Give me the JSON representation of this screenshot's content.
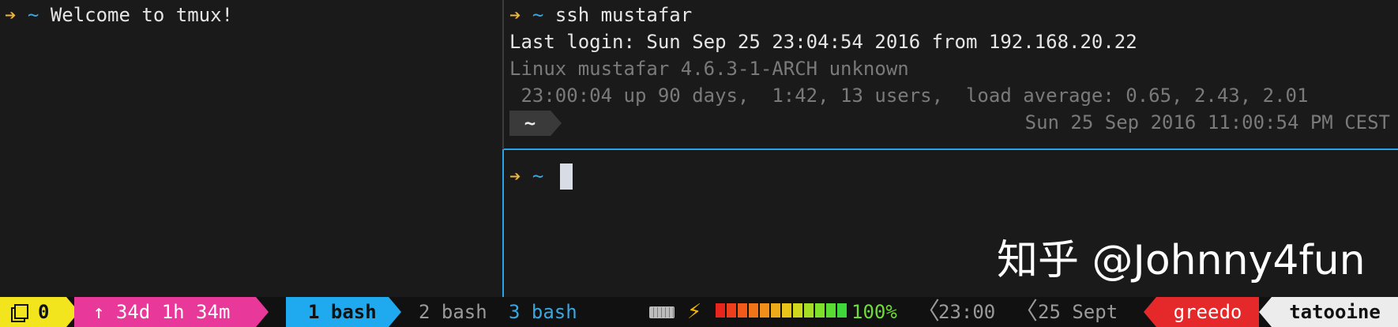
{
  "left_pane": {
    "prompt_arrow": "➔",
    "prompt_dir": "~",
    "message": "Welcome to tmux!"
  },
  "top_pane": {
    "prompt_arrow": "➔",
    "prompt_dir": "~",
    "command": "ssh mustafar",
    "last_login": "Last login: Sun Sep 25 23:04:54 2016 from 192.168.20.22",
    "uname": "Linux mustafar 4.6.3-1-ARCH unknown",
    "uptime_line": " 23:00:04 up 90 days,  1:42, 13 users,  load average: 0.65, 2.43, 2.01",
    "ps1_dir": "~",
    "remote_datetime": "Sun 25 Sep 2016 11:00:54 PM CEST"
  },
  "bottom_pane": {
    "prompt_arrow": "➔",
    "prompt_dir": "~"
  },
  "watermark": "知乎 @Johnny4fun",
  "statusbar": {
    "session": "0",
    "uptime": "↑ 34d 1h 34m",
    "windows": [
      {
        "label": "1 bash",
        "state": "active"
      },
      {
        "label": "2 bash",
        "state": "inactive"
      },
      {
        "label": "3 bash",
        "state": "last"
      }
    ],
    "battery_percent": "100%",
    "battery_level": 1.0,
    "battery_colors": [
      "#e8251d",
      "#ee3f1c",
      "#f25a1b",
      "#f2741a",
      "#f08f1a",
      "#edaa19",
      "#e8c419",
      "#cfd81c",
      "#a5dd24",
      "#7fe02c",
      "#5bdc33",
      "#3fd83a"
    ],
    "time": "23:00",
    "date": "25 Sept",
    "user": "greedo",
    "host": "tatooine",
    "colors": {
      "session_bg": "#f2e51e",
      "uptime_bg": "#e8389a",
      "active_window_bg": "#1fa9ee",
      "user_bg": "#e5282a",
      "host_bg": "#ececec",
      "active_border": "#2aa2e6"
    }
  }
}
